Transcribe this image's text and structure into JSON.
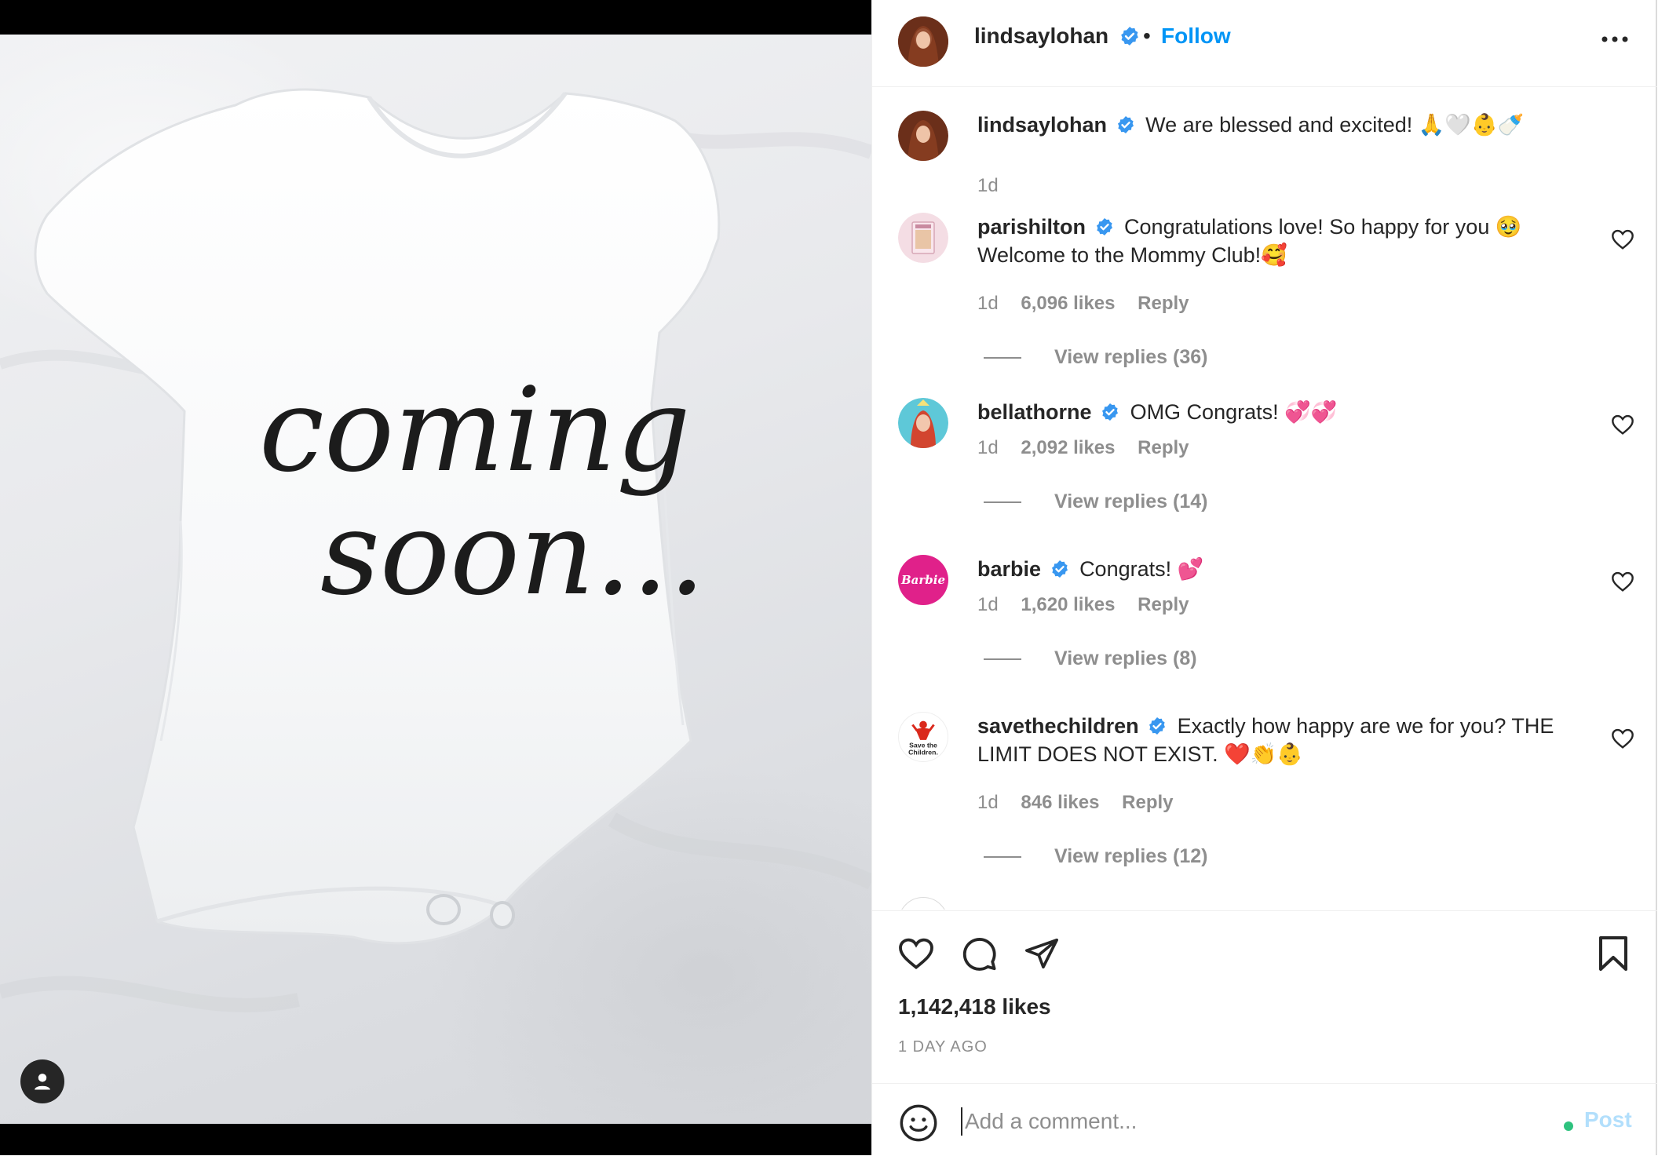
{
  "colors": {
    "accent": "#0095f6",
    "verified": "#3897f0",
    "muted": "#8e8e8e",
    "post_disabled": "#b2dffc",
    "barbie_pink": "#e0218a",
    "status_dot": "#2ec27e"
  },
  "post": {
    "image_text_line1": "coming",
    "image_text_line2": "soon..."
  },
  "header": {
    "username": "lindsaylohan",
    "separator": "•",
    "follow_label": "Follow",
    "more_icon": "more-horizontal-icon"
  },
  "caption": {
    "username": "lindsaylohan",
    "text": "We are blessed and excited! 🙏🤍👶🍼",
    "time": "1d"
  },
  "comments": [
    {
      "username": "parishilton",
      "text": "Congratulations love! So happy for you 🥹 Welcome to the Mommy Club!🥰",
      "time": "1d",
      "likes": "6,096 likes",
      "reply": "Reply",
      "view_replies": "View replies (36)"
    },
    {
      "username": "bellathorne",
      "text": "OMG Congrats! 💞💞",
      "time": "1d",
      "likes": "2,092 likes",
      "reply": "Reply",
      "view_replies": "View replies (14)"
    },
    {
      "username": "barbie",
      "text": "Congrats! 💕",
      "time": "1d",
      "likes": "1,620 likes",
      "reply": "Reply",
      "view_replies": "View replies (8)",
      "avatar_text": "Barbie"
    },
    {
      "username": "savethechildren",
      "text": "Exactly how happy are we for you? THE LIMIT DOES NOT EXIST. ❤️👏👶",
      "time": "1d",
      "likes": "846 likes",
      "reply": "Reply",
      "view_replies": "View replies (12)",
      "avatar_text": "Save the Children."
    }
  ],
  "actions": {
    "like_icon": "heart-icon",
    "comment_icon": "comment-icon",
    "share_icon": "send-icon",
    "save_icon": "bookmark-icon",
    "likes": "1,142,418 likes",
    "date": "1 DAY AGO"
  },
  "add_comment": {
    "placeholder": "Add a comment...",
    "post_label": "Post",
    "emoji_icon": "emoji-icon"
  }
}
